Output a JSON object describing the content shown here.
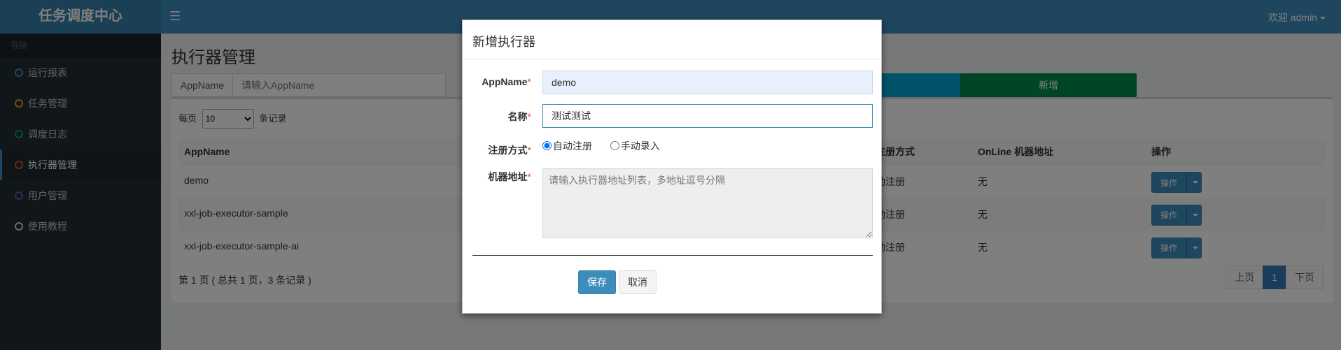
{
  "app": {
    "title": "任务调度中心"
  },
  "header": {
    "menu_icon": "☰",
    "user_label": "欢迎 admin"
  },
  "sidebar": {
    "heading": "导航",
    "items": [
      {
        "label": "运行报表",
        "color": "#3c8dbc"
      },
      {
        "label": "任务管理",
        "color": "#f39c12"
      },
      {
        "label": "调度日志",
        "color": "#00a65a"
      },
      {
        "label": "执行器管理",
        "color": "#dd4b39",
        "active": true
      },
      {
        "label": "用户管理",
        "color": "#605ca8"
      },
      {
        "label": "使用教程",
        "color": "#d2d6de"
      }
    ]
  },
  "main": {
    "page_title": "执行器管理",
    "filter": {
      "label": "AppName",
      "placeholder": "请输入AppName"
    },
    "add_button": "新增",
    "page_size": {
      "prefix": "每页",
      "value": "10",
      "suffix": "条记录"
    },
    "table": {
      "columns": [
        "AppName",
        "注册方式",
        "OnLine 机器地址",
        "操作"
      ],
      "rows": [
        {
          "app_name": "demo",
          "register": "动注册",
          "online": "无",
          "op": "操作"
        },
        {
          "app_name": "xxl-job-executor-sample",
          "register": "动注册",
          "online": "无",
          "op": "操作"
        },
        {
          "app_name": "xxl-job-executor-sample-ai",
          "register": "动注册",
          "online": "无",
          "op": "操作"
        }
      ]
    },
    "page_info": "第 1 页 ( 总共 1 页，3 条记录 )",
    "pager": {
      "prev": "上页",
      "current": "1",
      "next": "下页"
    }
  },
  "modal": {
    "title": "新增执行器",
    "fields": {
      "appname": {
        "label": "AppName",
        "value": "demo"
      },
      "name": {
        "label": "名称",
        "value": "测试测试"
      },
      "register_type": {
        "label": "注册方式",
        "options": [
          "自动注册",
          "手动录入"
        ],
        "selected": "自动注册"
      },
      "address": {
        "label": "机器地址",
        "placeholder": "请输入执行器地址列表，多地址逗号分隔"
      }
    },
    "required_mark": "*",
    "save_label": "保存",
    "cancel_label": "取消"
  }
}
